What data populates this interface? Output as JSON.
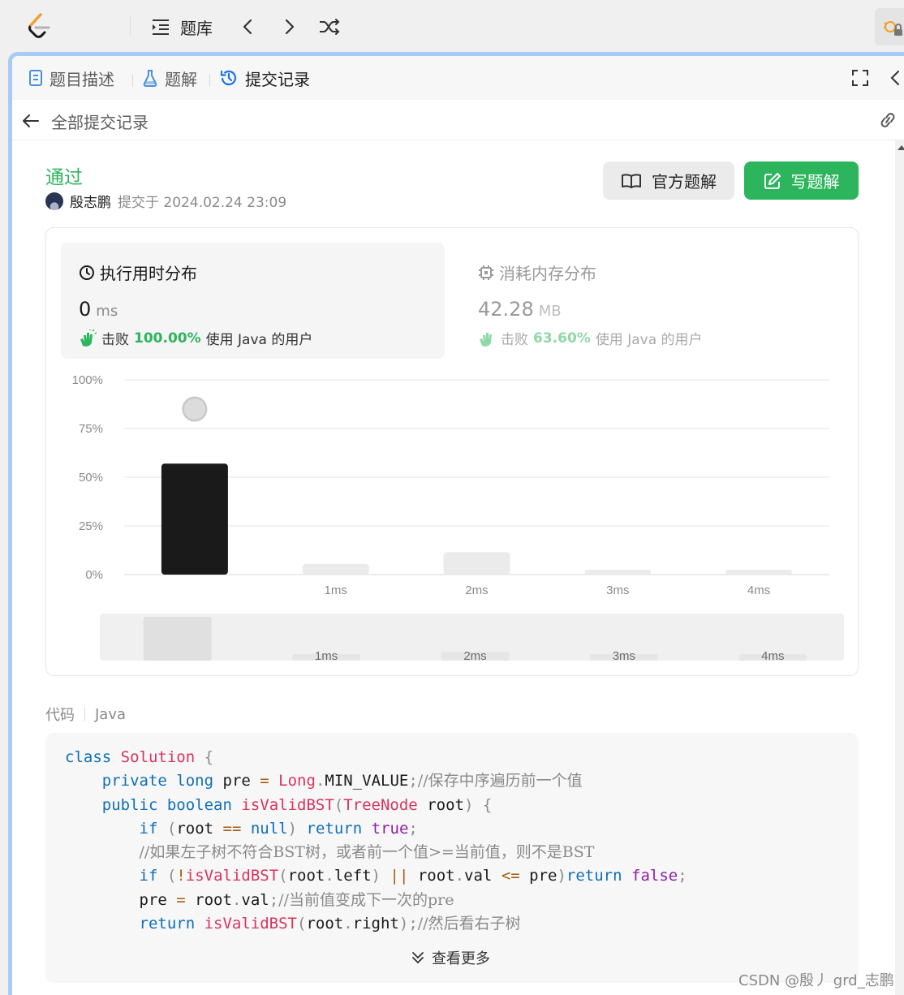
{
  "topbar": {
    "problems_label": "题库"
  },
  "tabs": [
    {
      "label": "题目描述"
    },
    {
      "label": "题解"
    },
    {
      "label": "提交记录"
    }
  ],
  "subheader": {
    "title": "全部提交记录"
  },
  "submission": {
    "status": "通过",
    "author": "殷志鹏",
    "submitted_at": "提交于 2024.02.24 23:09"
  },
  "buttons": {
    "official": "官方题解",
    "write": "写题解"
  },
  "runtime": {
    "title": "执行用时分布",
    "value": "0",
    "unit": "ms",
    "beat_prefix": "击败",
    "beat_pct": "100.00%",
    "beat_suffix": "使用 Java 的用户"
  },
  "memory": {
    "title": "消耗内存分布",
    "value": "42.28",
    "unit": "MB",
    "beat_prefix": "击败",
    "beat_pct": "63.60%",
    "beat_suffix": "使用 Java 的用户"
  },
  "chart_data": {
    "type": "bar",
    "categories": [
      "0ms",
      "1ms",
      "2ms",
      "3ms",
      "4ms"
    ],
    "x_tick_labels": [
      "",
      "1ms",
      "2ms",
      "3ms",
      "4ms"
    ],
    "values": [
      57,
      5.5,
      11.5,
      2.5,
      2.5
    ],
    "highlight_index": 0,
    "ylim": [
      0,
      100
    ],
    "y_tick_labels": [
      "100%",
      "75%",
      "50%",
      "25%",
      "0%"
    ],
    "grid": true,
    "overview_tick_labels": [
      "1ms",
      "2ms",
      "3ms",
      "4ms"
    ],
    "colors": {
      "highlight": "#1a1a1a",
      "bar": "#ebebeb",
      "grid": "#e6e6e6"
    }
  },
  "code": {
    "label": "代码",
    "language": "Java",
    "more": "查看更多"
  },
  "watermark": "CSDN @殷丿 grd_志鹏"
}
